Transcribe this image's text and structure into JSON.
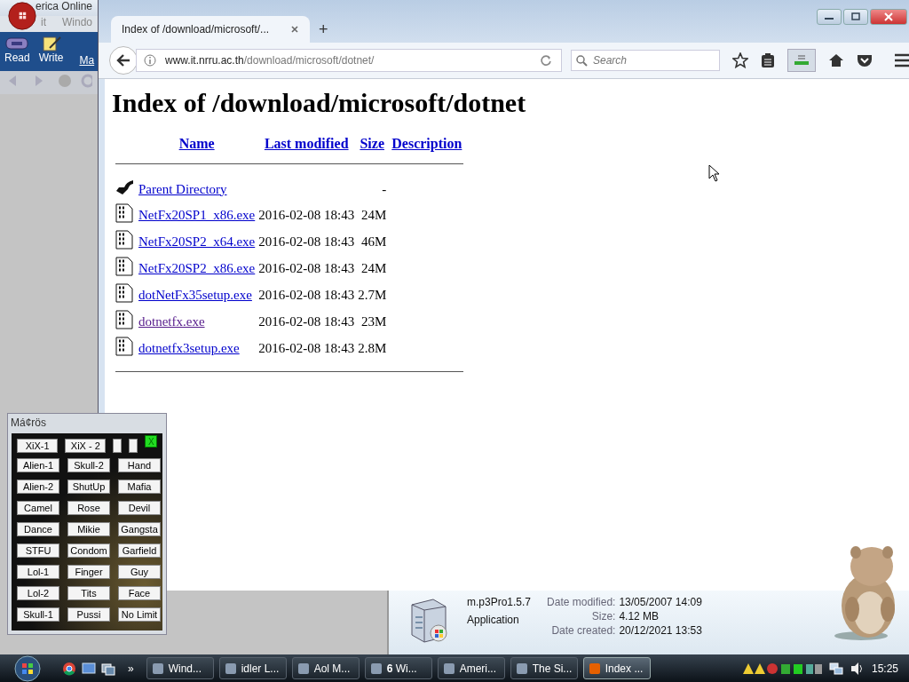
{
  "aol": {
    "title": "erica  Online",
    "menu": [
      "it",
      "Windo"
    ],
    "tools": [
      {
        "label": "Read",
        "kind": "read"
      },
      {
        "label": "Write",
        "kind": "write"
      },
      {
        "label": "Ma",
        "kind": "more"
      }
    ]
  },
  "browser": {
    "tab": {
      "title": "Index of /download/microsoft/...",
      "selected": true
    },
    "new_tab": "+",
    "url_host": "www.it.nrru.ac.th",
    "url_path": "/download/microsoft/dotnet/",
    "search": {
      "placeholder": "Search"
    },
    "page": {
      "heading": "Index of /download/microsoft/dotnet",
      "columns": [
        "Name",
        "Last modified",
        "Size",
        "Description"
      ],
      "rows": [
        {
          "kind": "parent",
          "name": "Parent Directory",
          "size": "-",
          "visited": false
        },
        {
          "kind": "file",
          "name": "NetFx20SP1_x86.exe",
          "modified": "2016-02-08 18:43",
          "size": "24M",
          "visited": false
        },
        {
          "kind": "file",
          "name": "NetFx20SP2_x64.exe",
          "modified": "2016-02-08 18:43",
          "size": "46M",
          "visited": false
        },
        {
          "kind": "file",
          "name": "NetFx20SP2_x86.exe",
          "modified": "2016-02-08 18:43",
          "size": "24M",
          "visited": false
        },
        {
          "kind": "file",
          "name": "dotNetFx35setup.exe",
          "modified": "2016-02-08 18:43",
          "size": "2.7M",
          "visited": false
        },
        {
          "kind": "file",
          "name": "dotnetfx.exe",
          "modified": "2016-02-08 18:43",
          "size": "23M",
          "visited": true
        },
        {
          "kind": "file",
          "name": "dotnetfx3setup.exe",
          "modified": "2016-02-08 18:43",
          "size": "2.8M",
          "visited": false
        }
      ]
    }
  },
  "macros": {
    "title": "Má¢rös",
    "close": "X",
    "buttons": [
      "XiX-1",
      "XiX - 2",
      "Alien-1",
      "Skull-2",
      "Hand",
      "Alien-2",
      "ShutUp",
      "Mafia",
      "Camel",
      "Rose",
      "Devil",
      "Dance",
      "Mikie",
      "Gangsta",
      "STFU",
      "Condom",
      "Garfield",
      "Lol-1",
      "Finger",
      "Guy",
      "Lol-2",
      "Tits",
      "Face",
      "Skull-1",
      "Pussi",
      "No Limit"
    ]
  },
  "details": {
    "name": "m.p3Pro1.5.7",
    "type": "Application",
    "fields": [
      {
        "label": "Date modified:",
        "value": "13/05/2007 14:09"
      },
      {
        "label": "Size:",
        "value": "4.12 MB"
      },
      {
        "label": "Date created:",
        "value": "20/12/2021 13:53"
      }
    ]
  },
  "taskbar": {
    "more": "»",
    "tasks": [
      {
        "label": "Wind...",
        "selected": false
      },
      {
        "label": "idler L...",
        "selected": false
      },
      {
        "label": "Aol M...",
        "selected": false
      },
      {
        "label": "**6** Wi...",
        "selected": false
      },
      {
        "label": "Ameri...",
        "selected": false
      },
      {
        "label": "The Si...",
        "selected": false
      },
      {
        "label": "Index ...",
        "selected": true
      }
    ],
    "clock": "15:25"
  }
}
